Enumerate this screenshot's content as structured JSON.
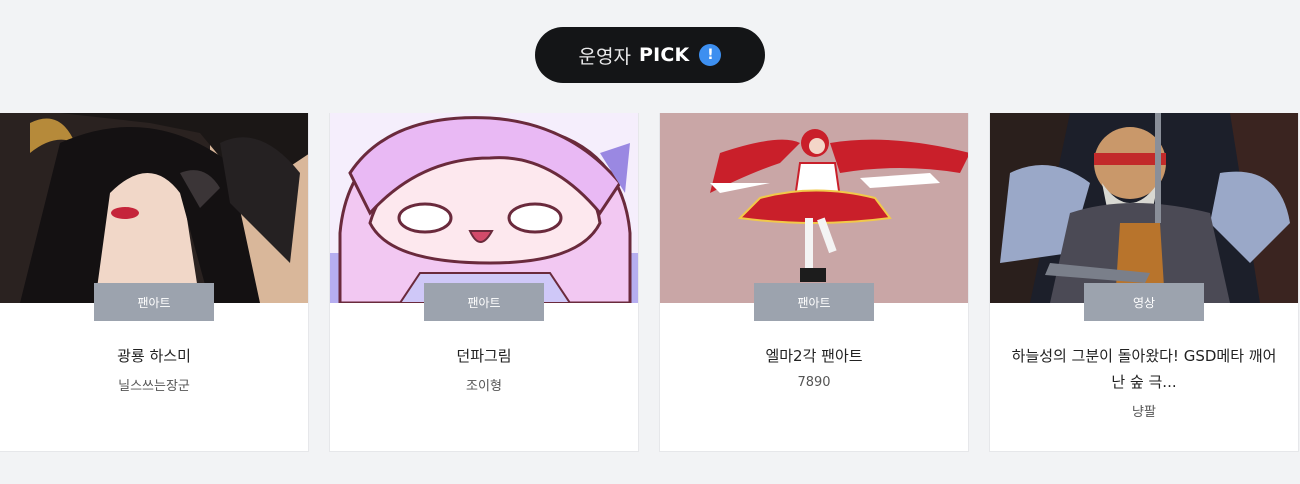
{
  "section": {
    "pill_prefix": "운영자",
    "pill_strong": "PICK",
    "info_glyph": "!",
    "colors": {
      "pill_bg": "#141517",
      "info_icon": "#3d8ff0",
      "badge_bg": "#9ca3ae",
      "page_bg": "#f2f3f5"
    }
  },
  "cards": [
    {
      "badge": "팬아트",
      "title": "광룡 하스미",
      "author": "닐스쓰는장군"
    },
    {
      "badge": "팬아트",
      "title": "던파그림",
      "author": "조이형"
    },
    {
      "badge": "팬아트",
      "title": "엘마2각 팬아트",
      "author": "7890"
    },
    {
      "badge": "영상",
      "title": "하늘성의 그분이 돌아왔다! GSD메타 깨어난 숲 극...",
      "author": "냥팔"
    }
  ]
}
